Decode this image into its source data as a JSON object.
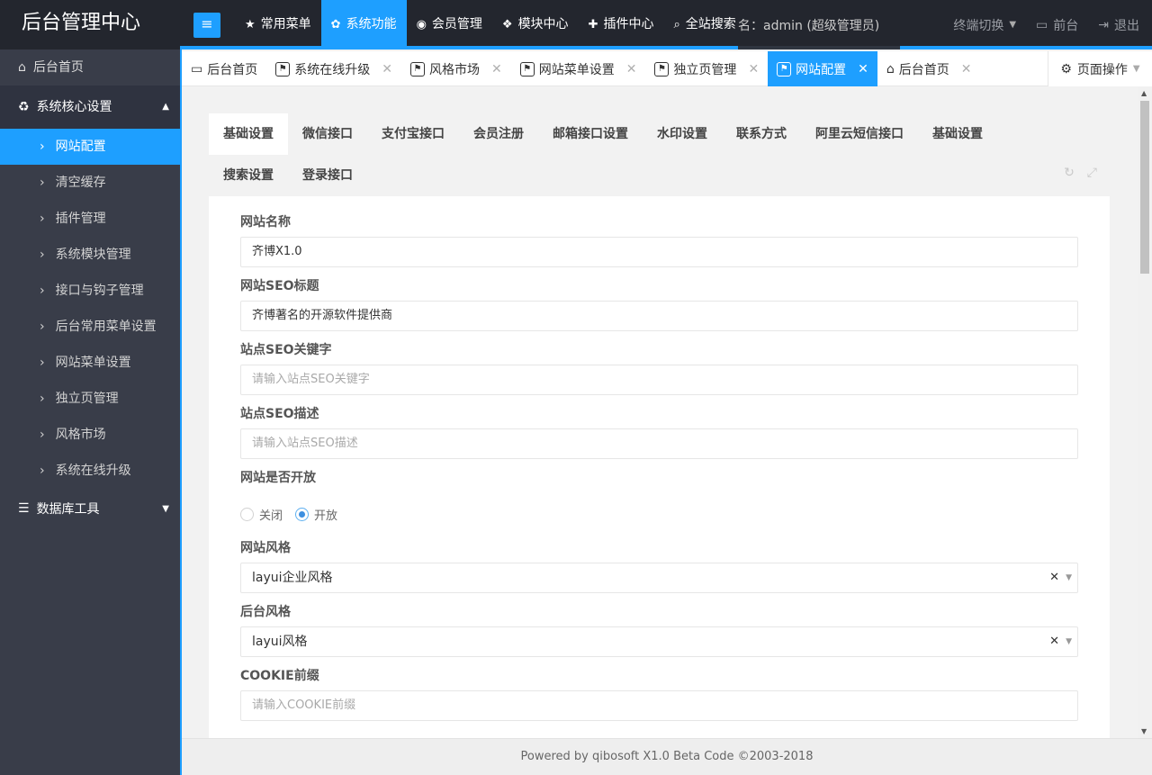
{
  "app_title": "后台管理中心",
  "topnav": [
    {
      "icon": "star-icon",
      "glyph": "★",
      "label": "常用菜单"
    },
    {
      "icon": "gear-icon",
      "glyph": "✿",
      "label": "系统功能"
    },
    {
      "icon": "user-circle-icon",
      "glyph": "◉",
      "label": "会员管理"
    },
    {
      "icon": "cubes-icon",
      "glyph": "❖",
      "label": "模块中心"
    },
    {
      "icon": "puzzle-icon",
      "glyph": "✚",
      "label": "插件中心"
    },
    {
      "icon": "search-icon",
      "glyph": "⌕",
      "label": "全站搜索"
    }
  ],
  "user": {
    "name_label": "名：admin (超级管理员)"
  },
  "header_right": {
    "terminal_switch": "终端切换",
    "frontend": "前台",
    "logout": "退出"
  },
  "sidebar": {
    "home": "后台首页",
    "group_core": "系统核心设置",
    "items": [
      "网站配置",
      "清空缓存",
      "插件管理",
      "系统模块管理",
      "接口与钩子管理",
      "后台常用菜单设置",
      "网站菜单设置",
      "独立页管理",
      "风格市场",
      "系统在线升级"
    ],
    "group_db": "数据库工具"
  },
  "tabs": [
    {
      "label": "后台首页",
      "icon": "monitor-icon",
      "closable": false
    },
    {
      "label": "系统在线升级",
      "icon": "flag-icon",
      "closable": true
    },
    {
      "label": "风格市场",
      "icon": "flag-icon",
      "closable": true
    },
    {
      "label": "网站菜单设置",
      "icon": "flag-icon",
      "closable": true
    },
    {
      "label": "独立页管理",
      "icon": "flag-icon",
      "closable": true
    },
    {
      "label": "网站配置",
      "icon": "flag-icon",
      "closable": true,
      "active": true
    },
    {
      "label": "后台首页",
      "icon": "home-icon",
      "closable": true
    }
  ],
  "page_ops": "页面操作",
  "card_tabs": {
    "row1": [
      "基础设置",
      "微信接口",
      "支付宝接口",
      "会员注册",
      "邮箱接口设置",
      "水印设置",
      "联系方式",
      "阿里云短信接口",
      "基础设置"
    ],
    "row2": [
      "搜索设置",
      "登录接口"
    ]
  },
  "form": {
    "site_name_label": "网站名称",
    "site_name_value": "齐博X1.0",
    "seo_title_label": "网站SEO标题",
    "seo_title_value": "齐博著名的开源软件提供商",
    "seo_keywords_label": "站点SEO关键字",
    "seo_keywords_placeholder": "请输入站点SEO关键字",
    "seo_desc_label": "站点SEO描述",
    "seo_desc_placeholder": "请输入站点SEO描述",
    "open_label": "网站是否开放",
    "open_off": "关闭",
    "open_on": "开放",
    "site_style_label": "网站风格",
    "site_style_value": "layui企业风格",
    "admin_style_label": "后台风格",
    "admin_style_value": "layui风格",
    "cookie_label": "COOKIE前缀",
    "cookie_placeholder": "请输入COOKIE前缀"
  },
  "footer": "Powered by  qibosoft X1.0 Beta Code ©2003-2018",
  "colors": {
    "accent": "#1e9fff",
    "sidebar": "#393d49",
    "header": "#23262e"
  }
}
